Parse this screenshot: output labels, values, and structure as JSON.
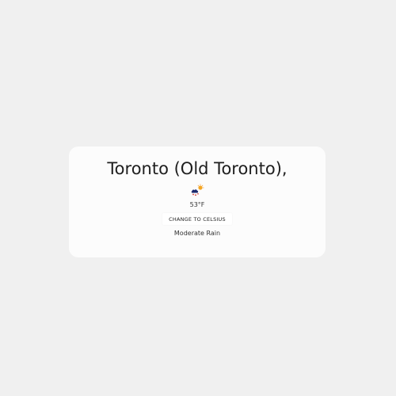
{
  "weather": {
    "city": "Toronto (Old Toronto),",
    "icon": "rain-sun-icon",
    "temperature": "53°F",
    "unit_button_label": "CHANGE TO CELSIUS",
    "condition": "Moderate Rain"
  },
  "colors": {
    "background": "#f0f0f0",
    "card": "#fcfcfc",
    "text": "#1e1e1e"
  }
}
